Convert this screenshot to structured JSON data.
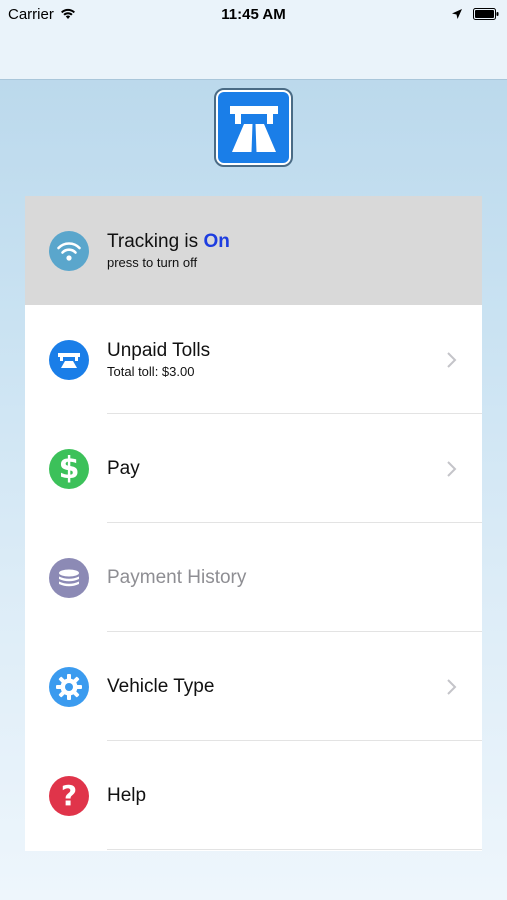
{
  "status_bar": {
    "carrier": "Carrier",
    "time": "11:45 AM"
  },
  "app": {
    "logo_icon": "toll-road-icon",
    "brand_color": "#1a7ee8"
  },
  "menu": {
    "tracking": {
      "title_prefix": "Tracking is ",
      "state": "On",
      "subtitle": "press to turn off",
      "icon": "wifi-icon",
      "icon_color": "#5aa6cc"
    },
    "items": [
      {
        "label": "Unpaid Tolls",
        "subtitle": "Total toll: $3.00",
        "icon": "toll-booth-icon",
        "icon_color": "#1a7ee8"
      },
      {
        "label": "Pay",
        "icon": "dollar-icon",
        "icon_color": "#3cc15a"
      },
      {
        "label": "Payment History",
        "icon": "coins-stack-icon",
        "icon_color": "#8c8ab5"
      },
      {
        "label": "Vehicle Type",
        "icon": "gear-icon",
        "icon_color": "#3b9bef"
      },
      {
        "label": "Help",
        "icon": "question-icon",
        "icon_color": "#e0344a"
      }
    ]
  }
}
